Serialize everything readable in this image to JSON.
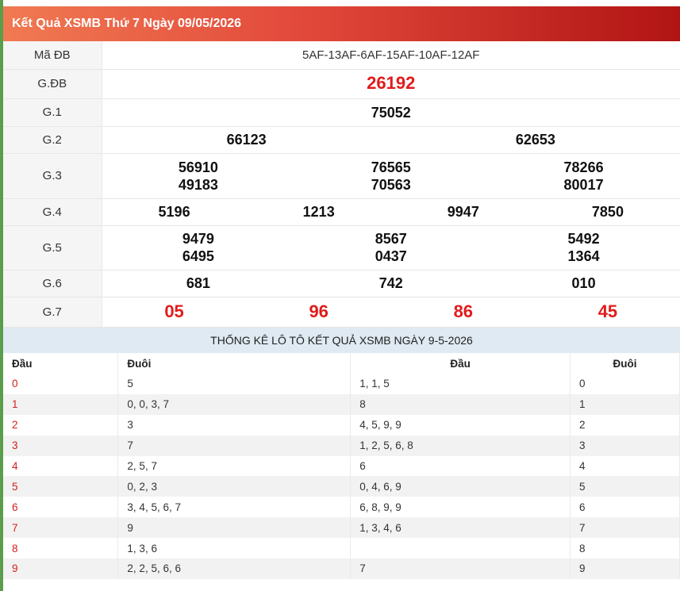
{
  "header": {
    "title": "Kết Quả XSMB Thứ 7 Ngày 09/05/2026"
  },
  "results": {
    "madb": {
      "label": "Mã ĐB",
      "value": "5AF-13AF-6AF-15AF-10AF-12AF"
    },
    "gdb": {
      "label": "G.ĐB",
      "value": "26192"
    },
    "g1": {
      "label": "G.1",
      "values": [
        "75052"
      ]
    },
    "g2": {
      "label": "G.2",
      "values": [
        "66123",
        "62653"
      ]
    },
    "g3": {
      "label": "G.3",
      "values": [
        "56910",
        "76565",
        "78266",
        "49183",
        "70563",
        "80017"
      ]
    },
    "g4": {
      "label": "G.4",
      "values": [
        "5196",
        "1213",
        "9947",
        "7850"
      ]
    },
    "g5": {
      "label": "G.5",
      "values": [
        "9479",
        "8567",
        "5492",
        "6495",
        "0437",
        "1364"
      ]
    },
    "g6": {
      "label": "G.6",
      "values": [
        "681",
        "742",
        "010"
      ]
    },
    "g7": {
      "label": "G.7",
      "values": [
        "05",
        "96",
        "86",
        "45"
      ]
    }
  },
  "stats": {
    "title": "THỐNG KÊ LÔ TÔ KẾT QUẢ XSMB NGÀY 9-5-2026",
    "headers": [
      "Đầu",
      "Đuôi",
      "Đầu",
      "Đuôi"
    ],
    "rows": [
      {
        "dau": "0",
        "duoi": "5",
        "dau2": "1, 1, 5",
        "duoi2": "0"
      },
      {
        "dau": "1",
        "duoi": "0, 0, 3, 7",
        "dau2": "8",
        "duoi2": "1"
      },
      {
        "dau": "2",
        "duoi": "3",
        "dau2": "4, 5, 9, 9",
        "duoi2": "2"
      },
      {
        "dau": "3",
        "duoi": "7",
        "dau2": "1, 2, 5, 6, 8",
        "duoi2": "3"
      },
      {
        "dau": "4",
        "duoi": "2, 5, 7",
        "dau2": "6",
        "duoi2": "4"
      },
      {
        "dau": "5",
        "duoi": "0, 2, 3",
        "dau2": "0, 4, 6, 9",
        "duoi2": "5"
      },
      {
        "dau": "6",
        "duoi": "3, 4, 5, 6, 7",
        "dau2": "6, 8, 9, 9",
        "duoi2": "6"
      },
      {
        "dau": "7",
        "duoi": "9",
        "dau2": "1, 3, 4, 6",
        "duoi2": "7"
      },
      {
        "dau": "8",
        "duoi": "1, 3, 6",
        "dau2": "",
        "duoi2": "8"
      },
      {
        "dau": "9",
        "duoi": "2, 2, 5, 6, 6",
        "dau2": "7",
        "duoi2": "9"
      }
    ]
  },
  "colors": {
    "accent_red": "#e11b1b",
    "header_start": "#f07a52",
    "header_end": "#b11414",
    "stats_title_bg": "#dfeaf2"
  }
}
